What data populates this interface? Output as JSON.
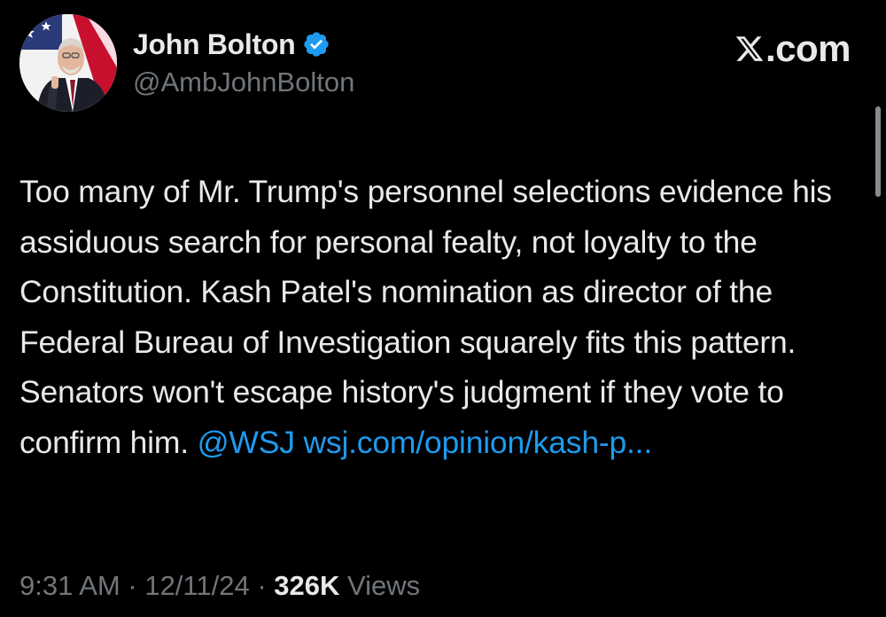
{
  "author": {
    "display_name": "John Bolton",
    "handle": "@AmbJohnBolton",
    "verified": true,
    "avatar_icon": "profile-photo"
  },
  "brand": {
    "text": ".com",
    "logo_icon": "x-logo-icon"
  },
  "tweet": {
    "text": "Too many of Mr. Trump's personnel selections evidence his assiduous search for personal fealty, not loyalty to the Constitution. Kash Patel's nomination as director of the Federal Bureau of Investigation squarely fits this pattern. Senators won't escape history's judgment if they vote to confirm him.",
    "mention": "@WSJ",
    "link_text": "wsj.com/opinion/kash-p..."
  },
  "meta": {
    "time": "9:31 AM",
    "date": "12/11/24",
    "separator": "·",
    "views_count": "326K",
    "views_label": "Views"
  },
  "colors": {
    "background": "#000000",
    "text": "#e7e9ea",
    "secondary": "#71767b",
    "link": "#1d9bf0",
    "verified": "#1d9bf0"
  }
}
